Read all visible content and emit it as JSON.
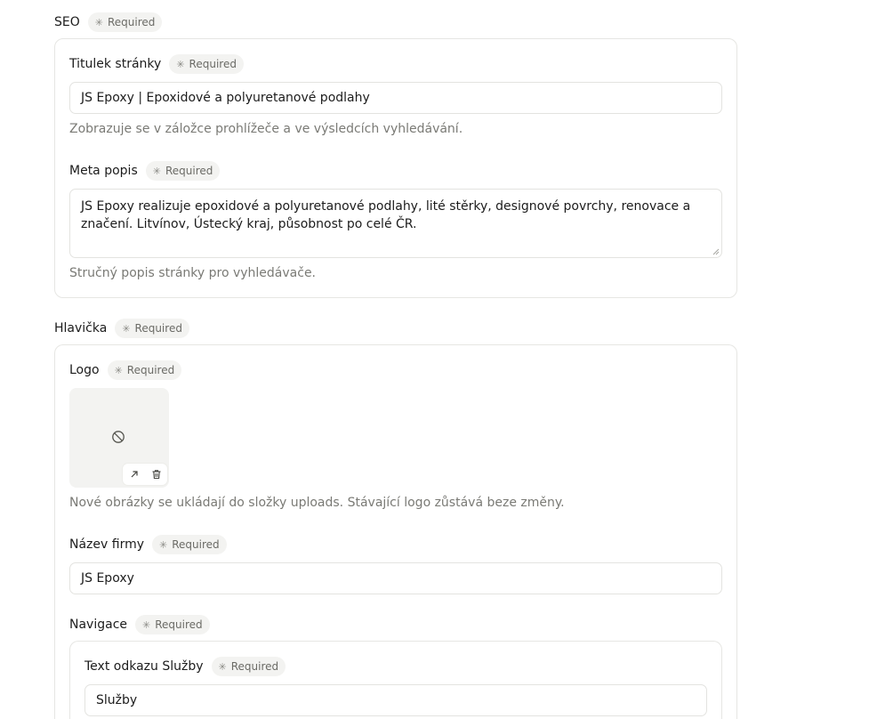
{
  "required_label": "Required",
  "seo": {
    "title": "SEO",
    "page_title": {
      "label": "Titulek stránky",
      "value": "JS Epoxy | Epoxidové a polyuretanové podlahy",
      "hint": "Zobrazuje se v záložce prohlížeče a ve výsledcích vyhledávání."
    },
    "meta_description": {
      "label": "Meta popis",
      "value": "JS Epoxy realizuje epoxidové a polyuretanové podlahy, lité stěrky, designové povrchy, renovace a značení. Litvínov, Ústecký kraj, působnost po celé ČR.",
      "hint": "Stručný popis stránky pro vyhledávače."
    }
  },
  "header": {
    "title": "Hlavička",
    "logo": {
      "label": "Logo",
      "hint": "Nové obrázky se ukládají do složky uploads. Stávající logo zůstává beze změny."
    },
    "company_name": {
      "label": "Název firmy",
      "value": "JS Epoxy"
    },
    "navigation": {
      "label": "Navigace",
      "services_link": {
        "label": "Text odkazu Služby",
        "value": "Služby"
      }
    }
  },
  "icons": {
    "required": "asterisk-icon",
    "no_image": "no-image-icon",
    "open": "arrow-up-right-icon",
    "delete": "trash-icon",
    "resize": "resize-grip-icon"
  },
  "colors": {
    "text": "#1c1c1c",
    "muted": "#7a7a75",
    "badge_bg": "#f3f3f1",
    "border": "#e6e6e3"
  }
}
